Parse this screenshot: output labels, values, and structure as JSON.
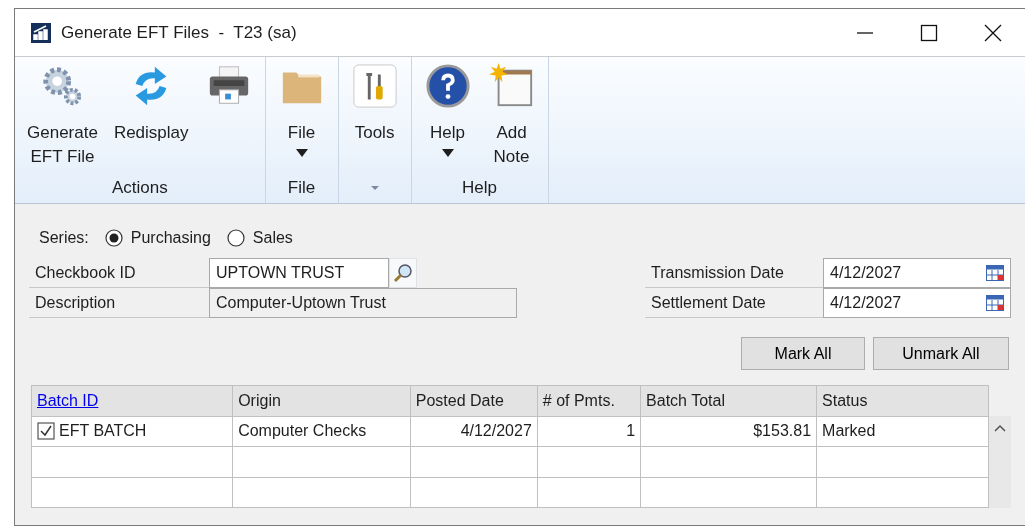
{
  "window": {
    "title": "Generate EFT Files  -  T23 (sa)"
  },
  "ribbon": {
    "groups": [
      {
        "label": "Actions",
        "dropdown_label": false,
        "buttons": [
          {
            "kind": "gears",
            "lines": [
              "Generate",
              "EFT File"
            ],
            "dropdown": false
          },
          {
            "kind": "refresh",
            "lines": [
              "Redisplay"
            ],
            "dropdown": false
          },
          {
            "kind": "printer",
            "dropdown": false
          }
        ]
      },
      {
        "label": "File",
        "dropdown_label": false,
        "buttons": [
          {
            "kind": "folder",
            "lines": [
              "File"
            ],
            "dropdown": true
          }
        ]
      },
      {
        "dropdown_label": true,
        "buttons": [
          {
            "kind": "tools",
            "lines": [
              "Tools"
            ],
            "dropdown": false
          }
        ]
      },
      {
        "label": "Help",
        "dropdown_label": false,
        "buttons": [
          {
            "kind": "help",
            "lines": [
              "Help"
            ],
            "dropdown": true
          },
          {
            "kind": "note",
            "lines": [
              "Add",
              "Note"
            ],
            "dropdown": false
          }
        ]
      }
    ]
  },
  "series": {
    "label": "Series:",
    "options": [
      {
        "label": "Purchasing",
        "selected": true
      },
      {
        "label": "Sales",
        "selected": false
      }
    ]
  },
  "checkbook": {
    "label": "Checkbook ID",
    "value": "UPTOWN TRUST"
  },
  "description": {
    "label": "Description",
    "value": "Computer-Uptown Trust"
  },
  "transmission_date": {
    "label": "Transmission Date",
    "value": "4/12/2027"
  },
  "settlement_date": {
    "label": "Settlement Date",
    "value": "4/12/2027"
  },
  "buttons": [
    "Mark All",
    "Unmark All"
  ],
  "grid": {
    "columns": [
      {
        "label": "Batch ID",
        "link": true
      },
      {
        "label": "Origin",
        "link": false
      },
      {
        "label": "Posted Date",
        "link": false
      },
      {
        "label": "# of Pmts.",
        "link": false
      },
      {
        "label": "Batch Total",
        "link": false
      },
      {
        "label": "Status",
        "link": false
      }
    ],
    "rows": [
      {
        "checked": true,
        "cells": [
          "EFT BATCH",
          "Computer Checks",
          "4/12/2027",
          "1",
          "$153.81",
          "Marked"
        ]
      }
    ]
  }
}
